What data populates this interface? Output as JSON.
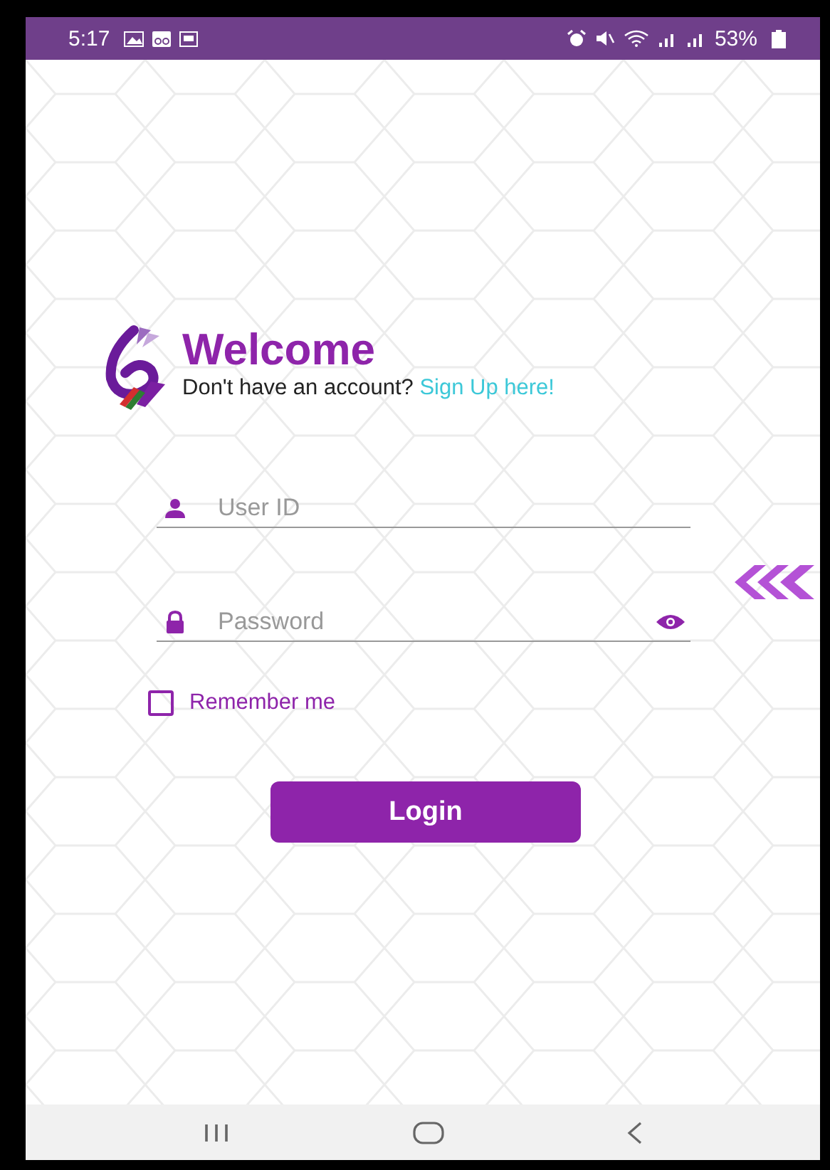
{
  "status_bar": {
    "time": "5:17",
    "battery": "53%"
  },
  "header": {
    "title": "Welcome",
    "prompt": "Don't have an account?",
    "link": "Sign Up here!"
  },
  "fields": [
    {
      "kind": "user",
      "placeholder": "User ID"
    },
    {
      "kind": "password",
      "placeholder": "Password"
    }
  ],
  "remember": {
    "label": "Remember me",
    "checked": false
  },
  "login_button": "Login"
}
